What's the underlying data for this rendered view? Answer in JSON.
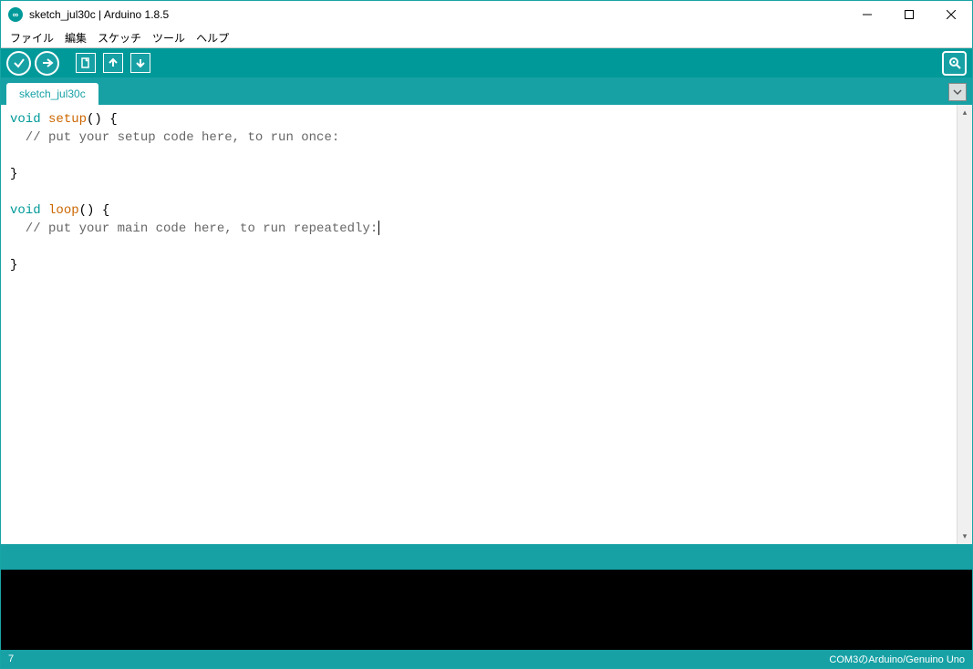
{
  "window": {
    "title": "sketch_jul30c | Arduino 1.8.5",
    "icon_text": "∞"
  },
  "menu": {
    "file": "ファイル",
    "edit": "編集",
    "sketch": "スケッチ",
    "tools": "ツール",
    "help": "ヘルプ"
  },
  "toolbar": {
    "verify": "verify",
    "upload": "upload",
    "new": "new",
    "open": "open",
    "save": "save",
    "serial": "serial-monitor"
  },
  "tab": {
    "name": "sketch_jul30c"
  },
  "code": {
    "l1_kw": "void",
    "l1_fn": "setup",
    "l1_rest": "() {",
    "l2_cm": "  // put your setup code here, to run once:",
    "l3": "",
    "l4": "}",
    "l5": "",
    "l6_kw": "void",
    "l6_fn": "loop",
    "l6_rest": "() {",
    "l7_cm": "  // put your main code here, to run repeatedly:",
    "l8": "",
    "l9": "}"
  },
  "bottom": {
    "line": "7",
    "board": "COM3のArduino/Genuino Uno"
  }
}
